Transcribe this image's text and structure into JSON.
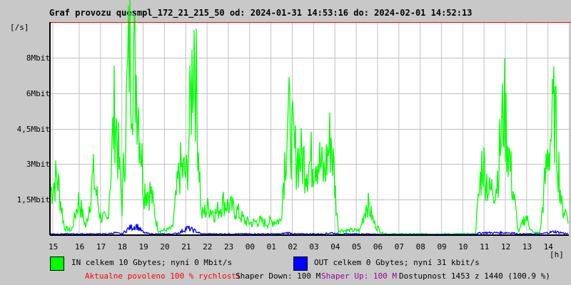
{
  "chart_data": {
    "type": "line",
    "title": "Graf provozu quesmpl_172_21_215_50 od: 2024-01-31 14:53:16 do: 2024-02-01 14:52:13",
    "ylabel": "[/s]",
    "xlabel": "[h]",
    "ylim": [
      0,
      9
    ],
    "y_ticks": [
      {
        "value": 1.5,
        "label": "1,5Mbit"
      },
      {
        "value": 3,
        "label": "3Mbit"
      },
      {
        "value": 4.5,
        "label": "4,5Mbit"
      },
      {
        "value": 6,
        "label": "6Mbit"
      },
      {
        "value": 7.5,
        "label": "8Mbit"
      }
    ],
    "x_ticks": [
      "15",
      "16",
      "17",
      "18",
      "19",
      "20",
      "21",
      "22",
      "23",
      "00",
      "01",
      "02",
      "03",
      "04",
      "05",
      "06",
      "07",
      "08",
      "09",
      "10",
      "11",
      "12",
      "13",
      "14"
    ],
    "grid": true,
    "series": [
      {
        "name": "IN",
        "color": "#00ff00",
        "unit": "Mbit/s",
        "values": [
          1.8,
          2.5,
          0.3,
          0.2,
          1.5,
          0.3,
          2.5,
          0.8,
          0.6,
          5.5,
          1.2,
          8.0,
          6.8,
          2.0,
          1.8,
          0.2,
          0.2,
          0.3,
          2.8,
          2.5,
          8.5,
          0.8,
          1.2,
          0.9,
          1.4,
          1.2,
          1.0,
          0.6,
          0.5,
          0.6,
          0.5,
          0.6,
          0.6,
          5.0,
          3.4,
          3.2,
          3.0,
          3.5,
          2.5,
          4.2,
          0.2,
          0.2,
          0.2,
          0.2,
          1.4,
          0.5,
          0.1,
          0.05,
          0.05,
          0.05,
          0.05,
          0.05,
          0.05,
          0.05,
          0.05,
          0.05,
          0.05,
          0.05,
          0.05,
          0.05,
          3.2,
          1.8,
          2.2,
          5.5,
          2.5,
          0.1,
          0.8,
          0.1,
          0.1,
          3.2,
          5.3,
          1.2,
          0.8
        ]
      },
      {
        "name": "OUT",
        "color": "#0000ff",
        "unit": "Mbit/s",
        "values": [
          0.05,
          0.05,
          0.05,
          0.05,
          0.05,
          0.05,
          0.05,
          0.05,
          0.05,
          0.1,
          0.05,
          0.3,
          0.4,
          0.1,
          0.05,
          0.05,
          0.05,
          0.05,
          0.1,
          0.3,
          0.2,
          0.05,
          0.05,
          0.05,
          0.05,
          0.05,
          0.05,
          0.05,
          0.05,
          0.05,
          0.05,
          0.05,
          0.05,
          0.1,
          0.05,
          0.05,
          0.05,
          0.05,
          0.05,
          0.1,
          0.05,
          0.05,
          0.05,
          0.05,
          0.05,
          0.05,
          0.02,
          0.02,
          0.02,
          0.02,
          0.02,
          0.02,
          0.02,
          0.02,
          0.02,
          0.02,
          0.02,
          0.02,
          0.02,
          0.05,
          0.1,
          0.1,
          0.1,
          0.1,
          0.1,
          0.05,
          0.05,
          0.05,
          0.05,
          0.1,
          0.15,
          0.1,
          0.05
        ]
      }
    ]
  },
  "legend": {
    "in_label": "IN celkem 10 Gbytes; nyní 0 Mbit/s",
    "out_label": "OUT celkem 0 Gbytes; nyní 31 kbit/s"
  },
  "status": {
    "allowed": "Aktualne povoleno 100 % rychlosti",
    "shaper_down": "Shaper Down: 100 M",
    "shaper_up": "Shaper Up: 100 M",
    "availability": "Dostupnost 1453 z 1440 (100.9 %)"
  }
}
